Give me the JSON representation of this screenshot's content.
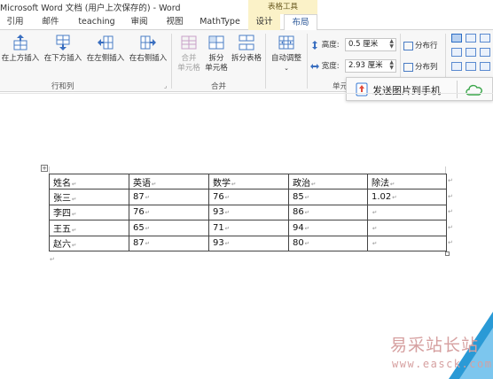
{
  "window": {
    "title": "Microsoft Word 文档 (用户上次保存的) - Word",
    "contextual_group": "表格工具"
  },
  "tabs": [
    {
      "label": "引用"
    },
    {
      "label": "邮件"
    },
    {
      "label": "teaching"
    },
    {
      "label": "审阅"
    },
    {
      "label": "视图"
    },
    {
      "label": "MathType"
    },
    {
      "label": "设计"
    },
    {
      "label": "布局"
    }
  ],
  "ribbon": {
    "rows_cols": {
      "group_label": "行和列",
      "buttons": [
        {
          "label": "在上方插入",
          "icon": "insert-above-icon"
        },
        {
          "label": "在下方插入",
          "icon": "insert-below-icon"
        },
        {
          "label": "在左侧插入",
          "icon": "insert-left-icon"
        },
        {
          "label": "在右侧插入",
          "icon": "insert-right-icon"
        }
      ]
    },
    "merge": {
      "group_label": "合并",
      "buttons": [
        {
          "label_line1": "合并",
          "label_line2": "单元格",
          "icon": "merge-cells-icon",
          "enabled": false
        },
        {
          "label_line1": "拆分",
          "label_line2": "单元格",
          "icon": "split-cells-icon",
          "enabled": true
        },
        {
          "label_line1": "拆分表格",
          "label_line2": "",
          "icon": "split-table-icon",
          "enabled": true
        }
      ]
    },
    "autofit": {
      "label": "自动调整",
      "icon": "autofit-icon"
    },
    "cell_size": {
      "group_label": "单元",
      "height_label": "高度:",
      "height_value": "0.5 厘米",
      "width_label": "宽度:",
      "width_value": "2.93 厘米",
      "distribute_rows": "分布行",
      "distribute_cols": "分布列"
    }
  },
  "popup": {
    "text": "发送图片到手机",
    "icon": "phone-upload-icon",
    "cloud_icon": "cloud-icon"
  },
  "table": {
    "headers": [
      "姓名",
      "英语",
      "数学",
      "政治",
      "除法"
    ],
    "rows": [
      [
        "张三",
        "87",
        "76",
        "85",
        "1.02"
      ],
      [
        "李四",
        "76",
        "93",
        "86",
        ""
      ],
      [
        "王五",
        "65",
        "71",
        "94",
        ""
      ],
      [
        "赵六",
        "87",
        "93",
        "80",
        ""
      ]
    ],
    "cell_mark": "↵"
  },
  "watermark": {
    "text": "易采站长站",
    "url": "www.easck.com"
  },
  "colors": {
    "contextual_tab": "#fbf2c8",
    "active_tab_text": "#2b5797",
    "icon_blue": "#4a7cc4",
    "popup_cloud": "#3aa64a"
  }
}
